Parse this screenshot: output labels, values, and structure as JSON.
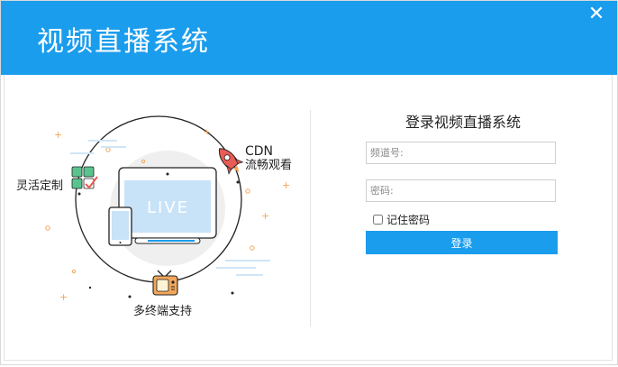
{
  "app": {
    "title": "视频直播系统",
    "close_label": "✕"
  },
  "illustration": {
    "screen_text": "LIVE",
    "features": {
      "custom": "灵活定制",
      "cdn_line1": "CDN",
      "cdn_line2": "流畅观看",
      "multi": "多终端支持"
    }
  },
  "login": {
    "heading": "登录视频直播系统",
    "channel_placeholder": "频道号:",
    "channel_value": "",
    "password_placeholder": "密码:",
    "password_value": "",
    "remember_label": "记住密码",
    "remember_checked": false,
    "submit_label": "登录"
  },
  "colors": {
    "brand": "#1b9ded",
    "accent_red": "#e85c55",
    "accent_green": "#5ac48f",
    "accent_orange": "#f2a65a"
  }
}
